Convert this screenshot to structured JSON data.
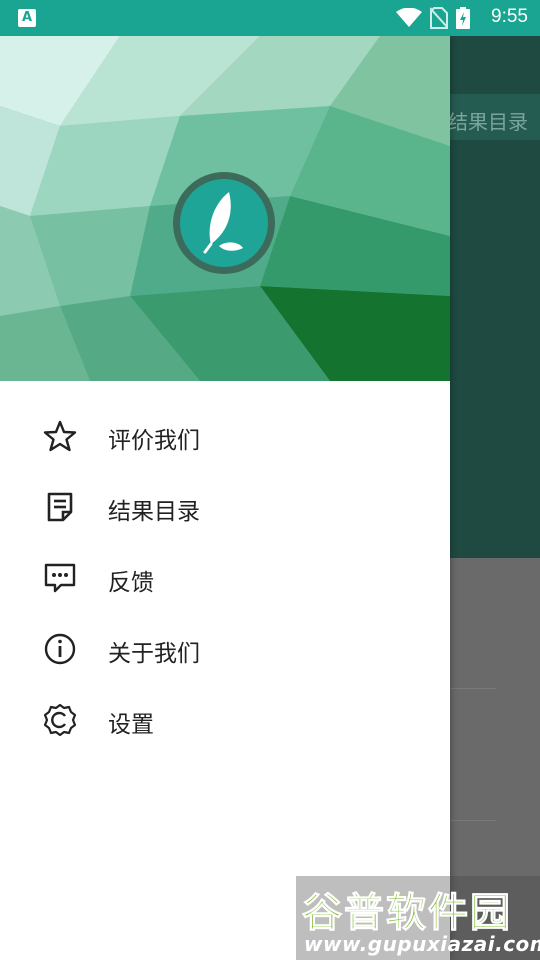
{
  "status_bar": {
    "time": "9:55",
    "notification_icon_letter": "A",
    "icons": [
      "wifi-icon",
      "no-sim-icon",
      "battery-charging-icon"
    ]
  },
  "background_app": {
    "toolbar_title": "结果目录"
  },
  "drawer": {
    "header_icon": "feather-logo-icon",
    "menu": [
      {
        "label": "评价我们",
        "icon": "star-icon"
      },
      {
        "label": "结果目录",
        "icon": "note-icon"
      },
      {
        "label": "反馈",
        "icon": "feedback-icon"
      },
      {
        "label": "关于我们",
        "icon": "info-icon"
      },
      {
        "label": "设置",
        "icon": "settings-icon"
      }
    ]
  },
  "watermark": {
    "title": "谷普软件园",
    "url": "www.gupuxiazai.com"
  },
  "colors": {
    "status_bar": "#1aa492",
    "accent": "#1fa597",
    "toolbar_dim": "#1e4a42"
  }
}
